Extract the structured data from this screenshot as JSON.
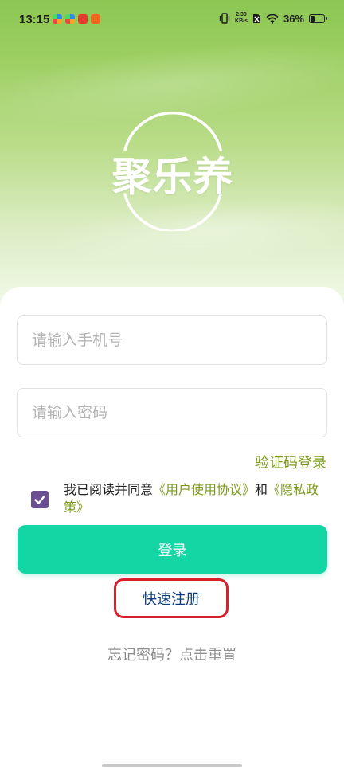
{
  "status_bar": {
    "time": "13:15",
    "net_speed_value": "2.30",
    "net_speed_unit": "KB/s",
    "battery_percent": "36%",
    "battery_level": 0.36
  },
  "logo": {
    "text": "聚乐养"
  },
  "form": {
    "phone_placeholder": "请输入手机号",
    "password_placeholder": "请输入密码",
    "sms_login_label": "验证码登录",
    "agreement_prefix": "我已阅读并同意",
    "user_agreement_link": "《用户使用协议》",
    "agreement_and": "和",
    "privacy_link": "《隐私政策》",
    "agreement_checked": true,
    "login_label": "登录",
    "register_label": "快速注册",
    "forgot_label": "忘记密码？点击重置"
  },
  "colors": {
    "accent_green": "#14d6a4",
    "link_olive": "#7a9a1a",
    "checkbox_purple": "#6b4f93",
    "highlight_red": "#d8202b",
    "register_blue": "#0d3d7a"
  }
}
